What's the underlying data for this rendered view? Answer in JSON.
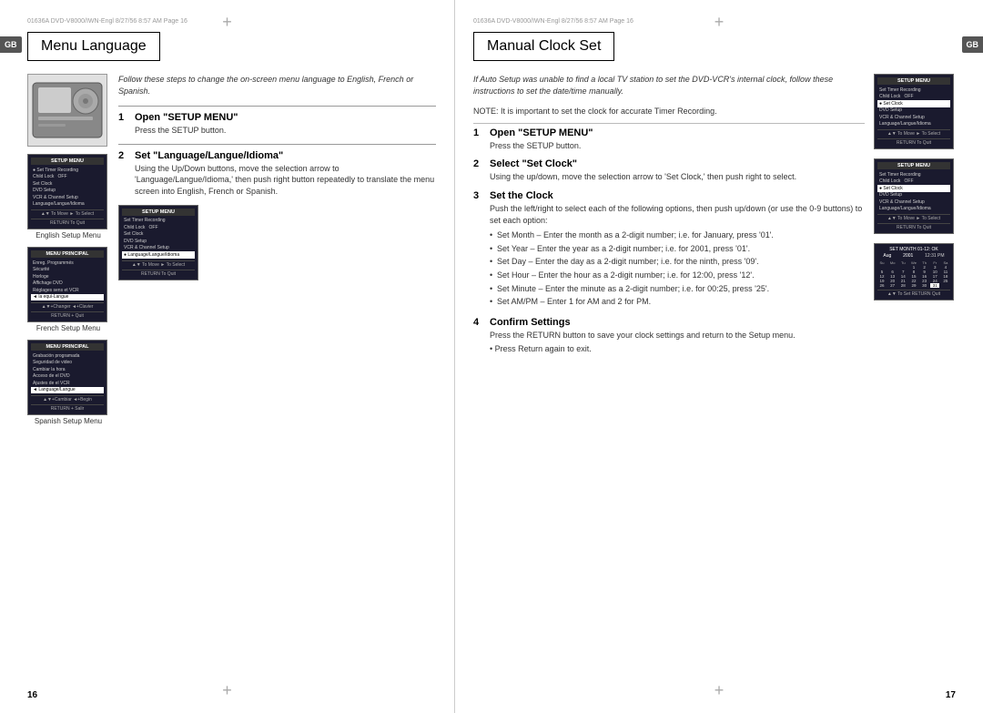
{
  "left_page": {
    "header_text": "01636A DVD-V8000/IWN-Engl  8/27/56  8:57 AM  Page 16",
    "title": "Menu Language",
    "gb_label": "GB",
    "intro": "Follow these steps to change the on-screen menu language to English, French or Spanish.",
    "steps": [
      {
        "num": "1",
        "title": "Open \"SETUP MENU\"",
        "text": "Press the SETUP button."
      },
      {
        "num": "2",
        "title": "Set \"Language/Langue/Idioma\"",
        "text": "Using the Up/Down buttons, move the selection arrow to 'Language/Langue/Idioma,' then push right button repeatedly to translate the menu screen into English, French or Spanish."
      }
    ],
    "menu_screens": [
      {
        "title": "SETUP MENU",
        "items": [
          "● Set Timer Recording",
          "Child Lock         OFF",
          "Set Clock",
          "DVD Setup",
          "VCR & Channel Setup",
          "Language/Langue/Idioma"
        ],
        "nav": "▲▼ To Move    ► To Select",
        "extra": "RETURN To Quit"
      },
      {
        "title": "SETUP MENU",
        "items": [
          "Set Timer Recording",
          "Child Lock         OFF",
          "Set Clock",
          "DVD Setup",
          "VCR & Channel Setup",
          "● Language/Langue/Idioma"
        ],
        "nav": "▲▼ To Move    ► To Select",
        "extra": "RETURN To Quit"
      }
    ],
    "setup_labels": [
      "English Setup Menu",
      "French Setup Menu",
      "Spanish Setup Menu"
    ],
    "french_menu": {
      "title": "MENU PRINCIPAL",
      "items": [
        "Enreg. Programmés",
        "Sécurité",
        "Horloge",
        "Affichage DVD",
        "Réglages sens et VCR",
        "◄ la equi-Langue/Idioma"
      ],
      "nav": "▲▼ + Changer  ◄ + Clavier",
      "extra": "RETURN + Quit"
    },
    "spanish_menu": {
      "title": "MENU PRINCIPAL",
      "items": [
        "Grabación programada",
        "Seguridad de video",
        "Cambiar la hora",
        "Acceso de el DVD",
        "Ajustes de el VCR",
        "◄ Language/Langue/Idioma"
      ],
      "nav": "▲▼ + Cambiar  ◄ + Begin",
      "extra": "RETURN + Salir"
    },
    "page_number": "16"
  },
  "right_page": {
    "title": "Manual Clock Set",
    "gb_label": "GB",
    "intro": "If Auto Setup was unable to find a local TV station to set the DVD-VCR's internal clock, follow these instructions to set the date/time manually.",
    "note": "NOTE:  It is important to set the clock for accurate Timer Recording.",
    "steps": [
      {
        "num": "1",
        "title": "Open \"SETUP MENU\"",
        "text": "Press the SETUP button."
      },
      {
        "num": "2",
        "title": "Select \"Set Clock\"",
        "text": "Using the up/down, move the selection arrow to 'Set Clock,' then push right to select."
      },
      {
        "num": "3",
        "title": "Set the Clock",
        "text": "Push the left/right to select each of the following options, then push up/down (or use the 0-9 buttons) to set each option:",
        "bullets": [
          "Set Month – Enter the month as a 2-digit number; i.e. for January, press '01'.",
          "Set Year – Enter the year as a 2-digit number; i.e. for 2001, press '01'.",
          "Set Day – Enter the day as a 2-digit number; i.e. for the ninth, press '09'.",
          "Set Hour – Enter the hour as a 2-digit number; i.e. for 12:00, press '12'.",
          "Set Minute – Enter the minute as a 2-digit number; i.e. for 00:25, press '25'.",
          "Set AM/PM – Enter 1 for AM and 2 for PM."
        ]
      },
      {
        "num": "4",
        "title": "Confirm Settings",
        "text": "Press the RETURN button to save your clock settings and return to the Setup menu.",
        "extra": "• Press Return again to exit."
      }
    ],
    "menu_screens": [
      {
        "title": "SETUP MENU",
        "items": [
          "Set Timer Recording",
          "Child Lock         OFF",
          "● Set Clock",
          "DVD Setup",
          "VCR & Channel Setup",
          "Language/Langue/Idioma"
        ],
        "nav": "▲▼ To Move    ► To Select",
        "extra": "RETURN To Quit"
      },
      {
        "title": "SETUP MENU",
        "items": [
          "Set Timer Recording",
          "Child Lock         OFF",
          "● Set Clock",
          "DVD Setup",
          "VCR & Channel Setup",
          "Language/Langue/Idioma"
        ],
        "nav": "▲▼ To Move    ► To Select",
        "extra": "RETURN To Quit"
      }
    ],
    "calendar": {
      "title": "SET MONTH 01 - 12: OK",
      "month_row": [
        "Aug",
        "2001",
        "12:31 PM"
      ],
      "headers": [
        "Su",
        "Mo",
        "Tu",
        "We",
        "Th",
        "Fr",
        "Sa"
      ],
      "rows": [
        [
          "",
          "",
          "",
          "1",
          "2",
          "3",
          "4"
        ],
        [
          "5",
          "6",
          "7",
          "8",
          "9",
          "10",
          "11"
        ],
        [
          "12",
          "13",
          "14",
          "15",
          "16",
          "17",
          "18"
        ],
        [
          "19",
          "20",
          "21",
          "22",
          "23",
          "24",
          "25"
        ],
        [
          "26",
          "27",
          "28",
          "29",
          "30",
          "31",
          ""
        ]
      ],
      "nav": "▲▼ To Set RETURN To Quit"
    },
    "page_number": "17"
  }
}
